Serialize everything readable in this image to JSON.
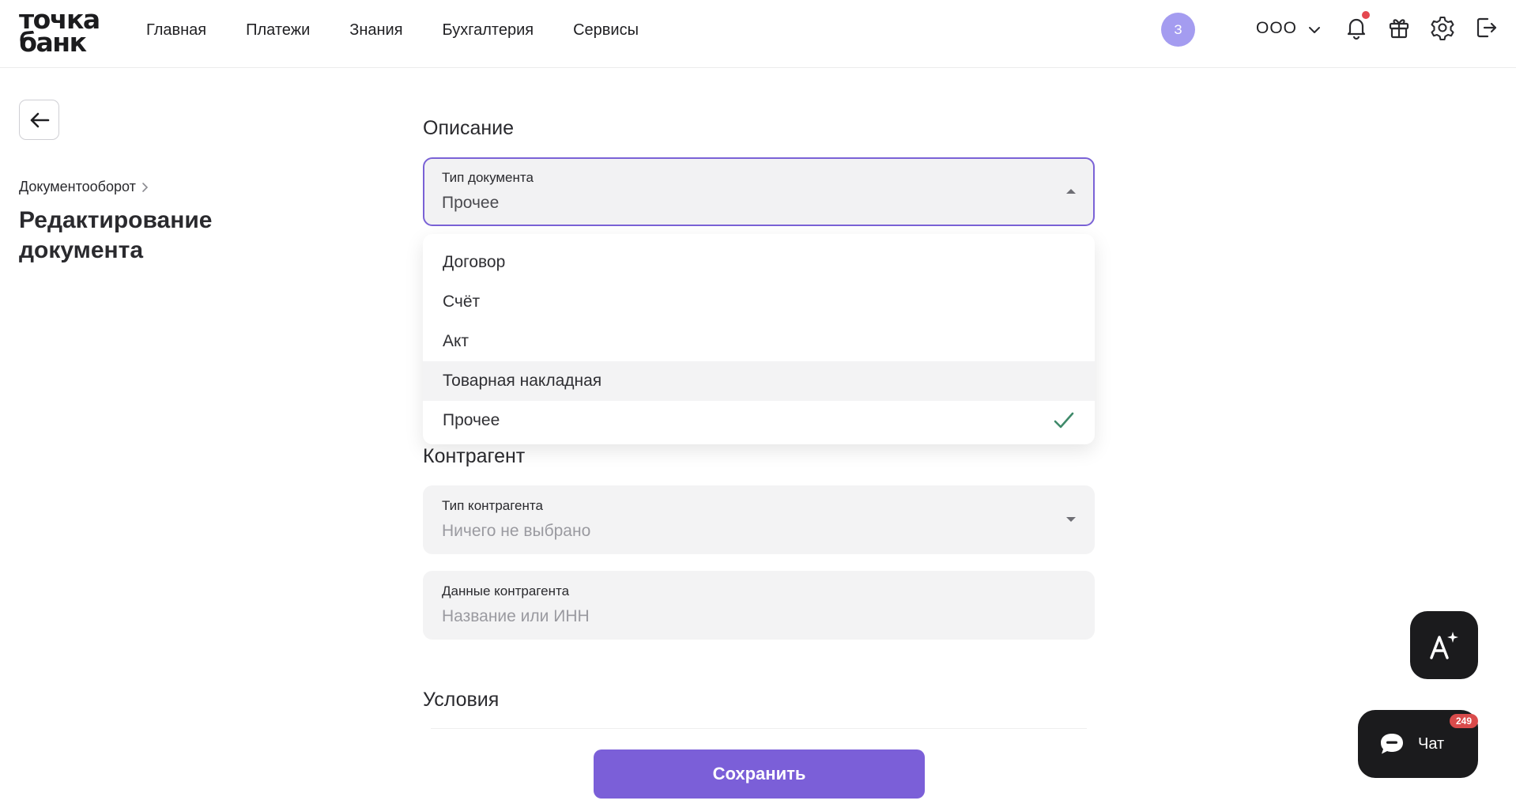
{
  "header": {
    "logo_line1": "точка",
    "logo_line2": "банк",
    "nav": [
      {
        "label": "Главная"
      },
      {
        "label": "Платежи"
      },
      {
        "label": "Знания"
      },
      {
        "label": "Бухгалтерия"
      },
      {
        "label": "Сервисы"
      }
    ],
    "avatar_letter": "З",
    "org_name": "ООО",
    "icons": [
      "bell-icon",
      "gift-icon",
      "gear-icon",
      "logout-icon"
    ]
  },
  "left": {
    "breadcrumb": "Документооборот",
    "page_title": "Редактирование документа"
  },
  "form": {
    "description_title": "Описание",
    "doc_type": {
      "label": "Тип документа",
      "value": "Прочее"
    },
    "dropdown": {
      "options": [
        {
          "label": "Договор"
        },
        {
          "label": "Счёт"
        },
        {
          "label": "Акт"
        },
        {
          "label": "Товарная накладная"
        },
        {
          "label": "Прочее"
        }
      ],
      "selected": "Прочее",
      "hovered": "Товарная накладная"
    },
    "counterparty_title": "Контрагент",
    "counterparty_type": {
      "label": "Тип контрагента",
      "placeholder": "Ничего не выбрано"
    },
    "counterparty_data": {
      "label": "Данные контрагента",
      "placeholder": "Название или ИНН"
    },
    "conditions_title": "Условия",
    "save_label": "Сохранить"
  },
  "floating": {
    "chat_label": "Чат",
    "chat_badge": "249"
  },
  "colors": {
    "accent": "#7b5fd8",
    "focus_border": "#7a62d6",
    "avatar": "#a49cf0",
    "notification_dot": "#e4474f",
    "check": "#3f8a6a"
  }
}
